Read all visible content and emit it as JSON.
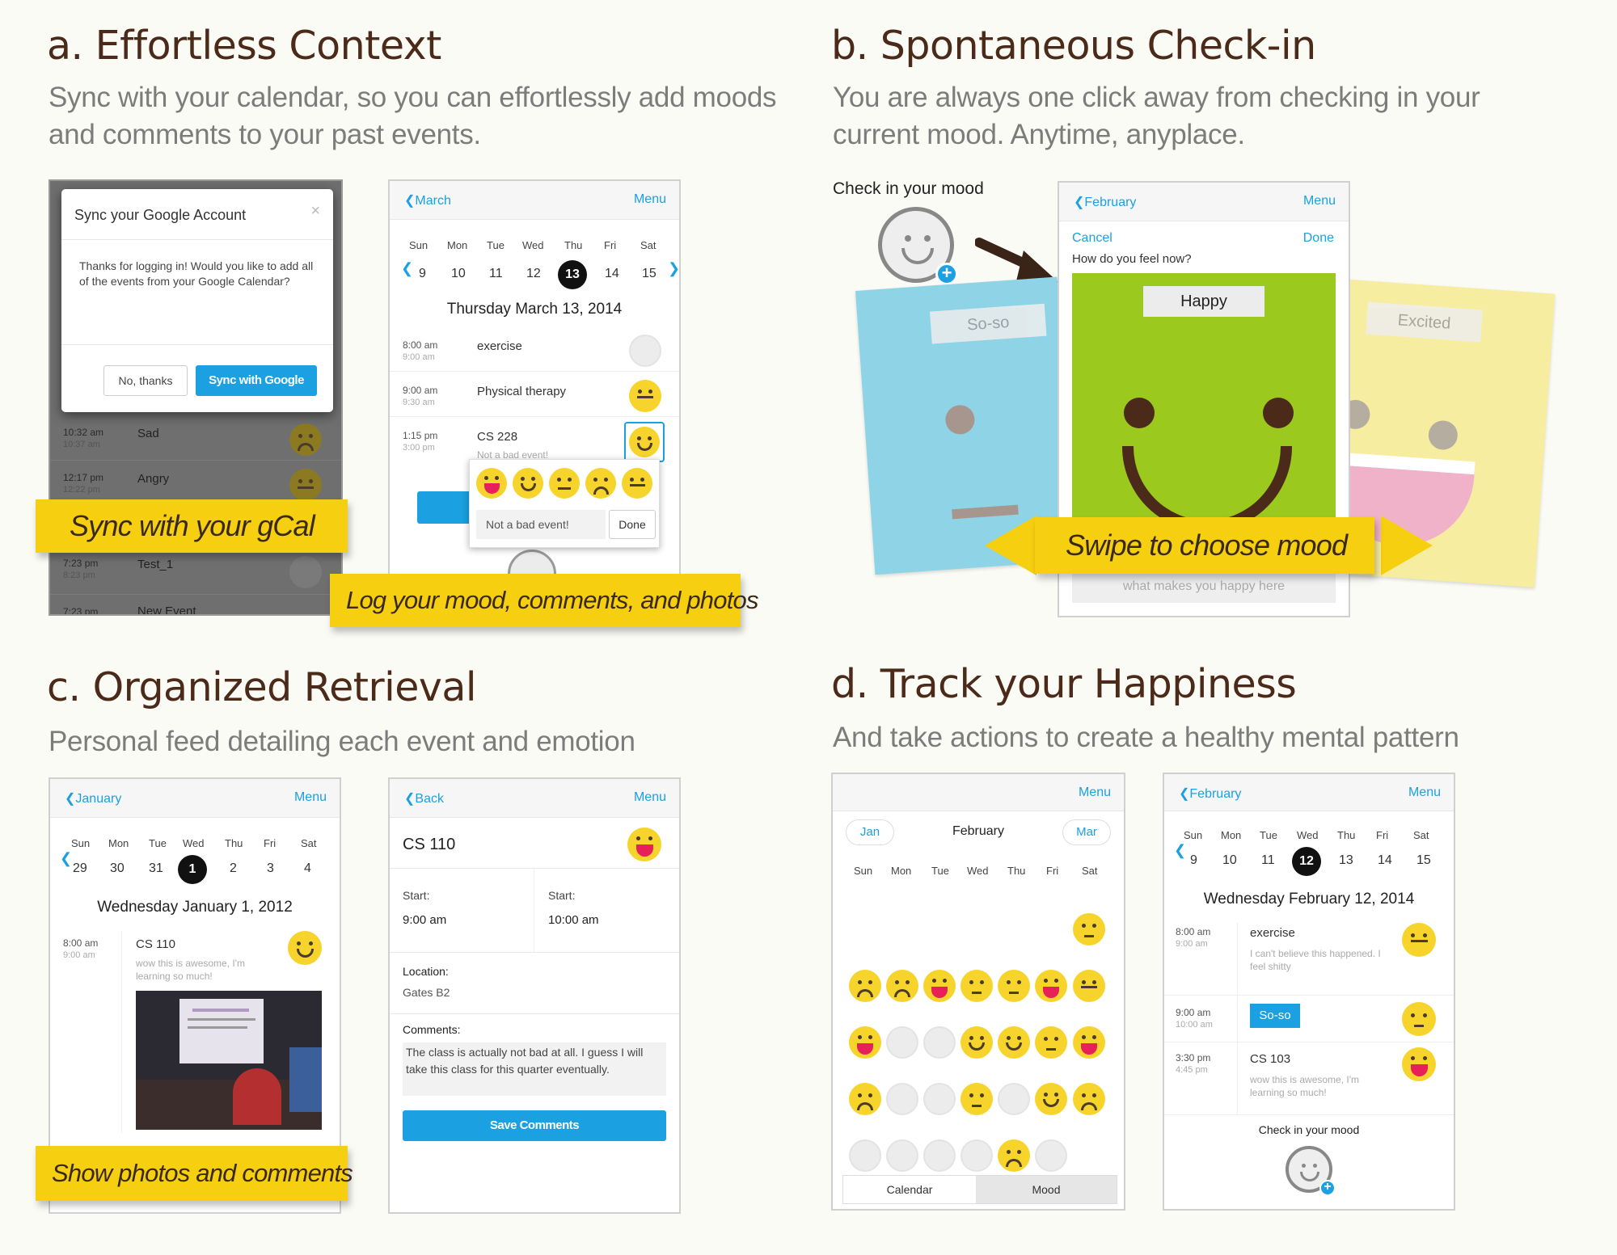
{
  "a": {
    "title": "a. Effortless Context",
    "subtitle_l1": "Sync with your calendar, so you can effortlessly add moods",
    "subtitle_l2": "and comments to your past events.",
    "dialog": {
      "title": "Sync your Google Account",
      "close": "×",
      "body": "Thanks for logging in! Would you like to add all of the events from your Google Calendar?",
      "no_label": "No, thanks",
      "yes_label": "Sync with Google"
    },
    "bg_rows": [
      {
        "time": "10:32 am",
        "end": "10:37 am",
        "name": "Sad"
      },
      {
        "time": "12:17 pm",
        "end": "12:22 pm",
        "name": "Angry"
      },
      {
        "time": "7:23 pm",
        "end": "8:23 pm",
        "name": "Test_1"
      },
      {
        "time": "7:23 pm",
        "end": "",
        "name": "New Event"
      }
    ],
    "banner1": "Sync with your gCal",
    "cal": {
      "back": "March",
      "menu": "Menu",
      "days": [
        "Sun",
        "Mon",
        "Tue",
        "Wed",
        "Thu",
        "Fri",
        "Sat"
      ],
      "dates": [
        "9",
        "10",
        "11",
        "12",
        "13",
        "14",
        "15"
      ],
      "heading": "Thursday March 13, 2014",
      "events": [
        {
          "time": "8:00 am",
          "end": "9:00 am",
          "name": "exercise",
          "note": ""
        },
        {
          "time": "9:00 am",
          "end": "9:30 am",
          "name": "Physical therapy",
          "note": ""
        },
        {
          "time": "1:15 pm",
          "end": "3:00 pm",
          "name": "CS 228",
          "note": "Not a bad event!"
        }
      ],
      "popup_comment": "Not a bad event!",
      "popup_done": "Done"
    },
    "banner2": "Log your mood, comments, and photos"
  },
  "b": {
    "title": "b. Spontaneous Check-in",
    "subtitle_l1": "You are always one click away from checking in your",
    "subtitle_l2": "current mood. Anytime, anyplace.",
    "checkin_label": "Check in your mood",
    "back": "February",
    "menu": "Menu",
    "cancel": "Cancel",
    "done": "Done",
    "question": "How do you feel now?",
    "card_left": "So-so",
    "card_center": "Happy",
    "card_right": "Excited",
    "share_prompt": "what makes you happy here",
    "banner": "Swipe to choose mood"
  },
  "c": {
    "title": "c. Organized Retrieval",
    "subtitle": "Personal feed detailing each event and emotion",
    "cal": {
      "back": "January",
      "menu": "Menu",
      "days": [
        "Sun",
        "Mon",
        "Tue",
        "Wed",
        "Thu",
        "Fri",
        "Sat"
      ],
      "dates": [
        "29",
        "30",
        "31",
        "1",
        "2",
        "3",
        "4"
      ],
      "heading": "Wednesday January 1, 2012",
      "event_time": "8:00 am",
      "event_end": "9:00 am",
      "event_name": "CS 110",
      "event_note": "wow this is awesome, I'm learning so much!"
    },
    "banner": "Show photos and comments",
    "detail": {
      "back": "Back",
      "menu": "Menu",
      "name": "CS 110",
      "start_label": "Start:",
      "start_value": "9:00 am",
      "end_label": "Start:",
      "end_value": "10:00 am",
      "location_label": "Location:",
      "location_value": "Gates B2",
      "comments_label": "Comments:",
      "comments_value": "The class is actually not bad at all. I guess I will take this class for this quarter eventually.",
      "save": "Save Comments"
    }
  },
  "d": {
    "title": "d. Track your Happiness",
    "subtitle": "And take actions to create a healthy mental pattern",
    "month": {
      "menu": "Menu",
      "prev": "Jan",
      "name": "February",
      "next": "Mar",
      "days": [
        "Sun",
        "Mon",
        "Tue",
        "Wed",
        "Thu",
        "Fri",
        "Sat"
      ],
      "tab_calendar": "Calendar",
      "tab_mood": "Mood"
    },
    "day": {
      "back": "February",
      "menu": "Menu",
      "days": [
        "Sun",
        "Mon",
        "Tue",
        "Wed",
        "Thu",
        "Fri",
        "Sat"
      ],
      "dates": [
        "9",
        "10",
        "11",
        "12",
        "13",
        "14",
        "15"
      ],
      "heading": "Wednesday February 12, 2014",
      "events": [
        {
          "time": "8:00 am",
          "end": "9:00 am",
          "name": "exercise",
          "note": "I can't believe this happened. I feel shitty"
        },
        {
          "time": "9:00 am",
          "end": "10:00 am",
          "name": "So-so",
          "note": ""
        },
        {
          "time": "3:30 pm",
          "end": "4:45 pm",
          "name": "CS 103",
          "note": "wow this is awesome, I'm learning so much!"
        }
      ],
      "checkin": "Check in your mood"
    }
  },
  "colors": {
    "brown": "#4b2a1a",
    "yellow": "#f6cf10",
    "blue": "#1ba0e1",
    "green": "#9bc91d",
    "skyblue": "#8fd3e6",
    "paleyellow": "#f7eda0"
  }
}
